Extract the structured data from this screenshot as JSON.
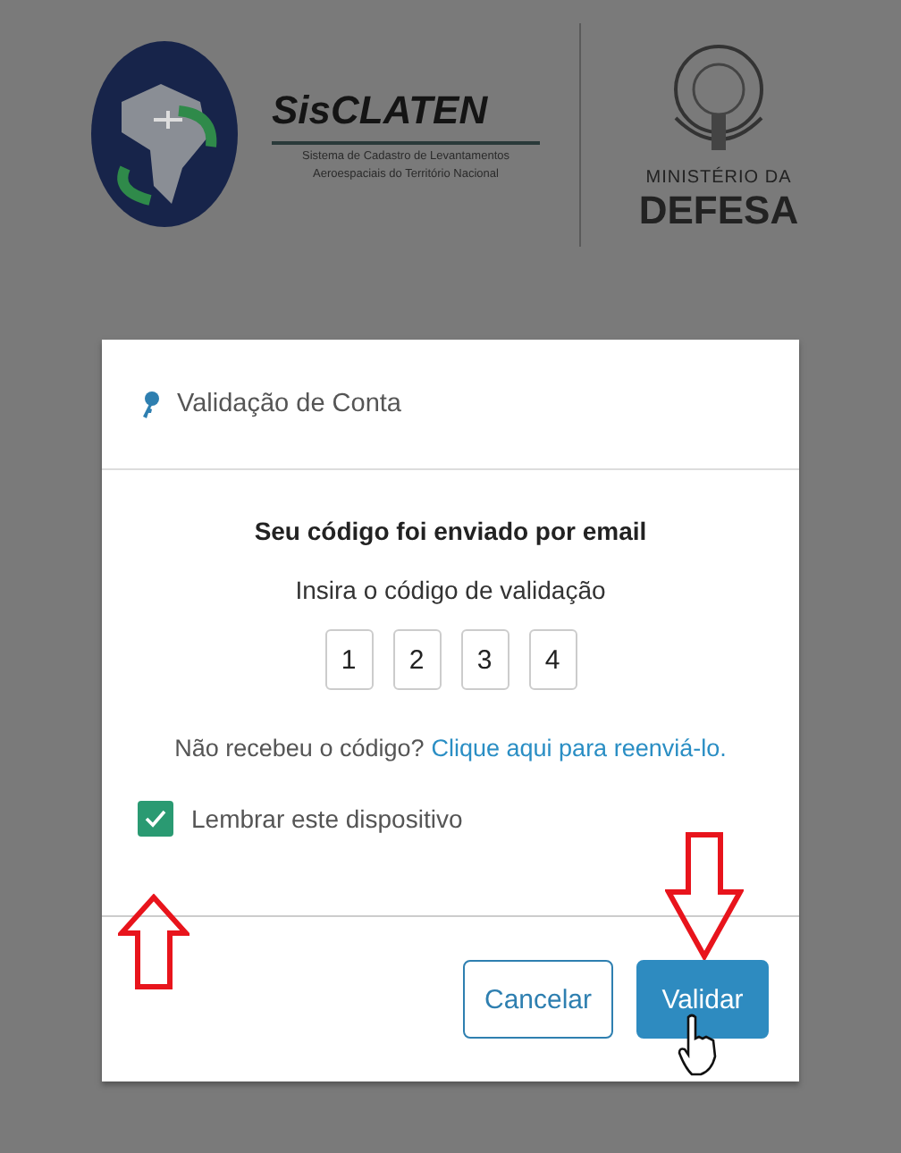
{
  "header": {
    "brand": "SisCLATEN",
    "brand_subtitle": [
      "Sistema de Cadastro de Levantamentos",
      "Aeroespaciais do Território Nacional"
    ],
    "ministry_line": "MINISTÉRIO DA",
    "ministry_name": "DEFESA"
  },
  "dialog": {
    "title": "Validação de Conta",
    "heading": "Seu código foi enviado por email",
    "prompt": "Insira o código de validação",
    "code_digits": [
      "1",
      "2",
      "3",
      "4"
    ],
    "resend_question": "Não recebeu o código?",
    "resend_link": "Clique aqui para reenviá-lo.",
    "remember": {
      "label": "Lembrar este dispositivo",
      "checked": true
    },
    "buttons": [
      {
        "label": "Cancelar",
        "kind": "secondary"
      },
      {
        "label": "Validar",
        "kind": "primary"
      }
    ]
  }
}
